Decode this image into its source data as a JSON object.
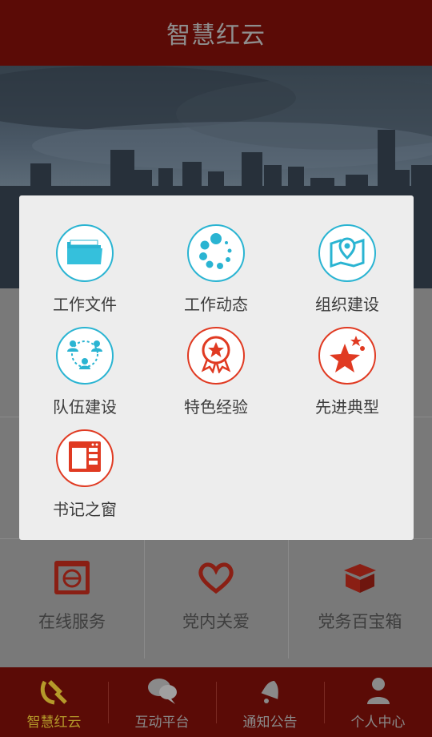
{
  "header": {
    "title": "智慧红云"
  },
  "menu": {
    "items": [
      {
        "label": "工作文件",
        "icon": "folder-icon",
        "color": "#2ab4d2"
      },
      {
        "label": "工作动态",
        "icon": "loading-dots-icon",
        "color": "#2ab4d2"
      },
      {
        "label": "组织建设",
        "icon": "map-pin-icon",
        "color": "#2ab4d2"
      },
      {
        "label": "队伍建设",
        "icon": "team-icon",
        "color": "#2ab4d2"
      },
      {
        "label": "特色经验",
        "icon": "award-ribbon-icon",
        "color": "#e03a22"
      },
      {
        "label": "先进典型",
        "icon": "star-icon",
        "color": "#e03a22"
      },
      {
        "label": "书记之窗",
        "icon": "window-icon",
        "color": "#e03a22"
      }
    ]
  },
  "services": [
    {
      "label": "在线服务",
      "icon": "online-service-icon"
    },
    {
      "label": "党内关爱",
      "icon": "heart-icon"
    },
    {
      "label": "党务百宝箱",
      "icon": "treasure-box-icon"
    }
  ],
  "tabs": [
    {
      "label": "智慧红云",
      "icon": "party-emblem-icon",
      "active": true
    },
    {
      "label": "互动平台",
      "icon": "chat-bubbles-icon",
      "active": false
    },
    {
      "label": "通知公告",
      "icon": "bell-icon",
      "active": false
    },
    {
      "label": "个人中心",
      "icon": "person-icon",
      "active": false
    }
  ],
  "colors": {
    "header_bg": "#5b0b06",
    "accent_blue": "#2ab4d2",
    "accent_red": "#e03a22",
    "active_tab": "#b59a2a"
  }
}
